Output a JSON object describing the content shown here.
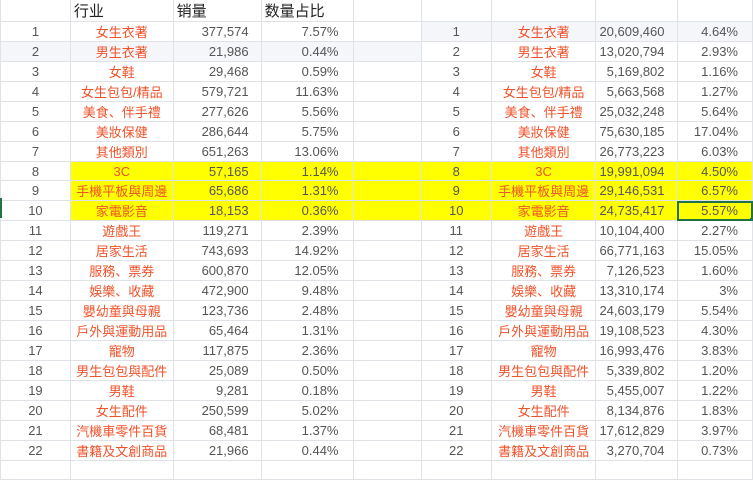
{
  "headers": {
    "category": "行业",
    "sales": "销量",
    "share": "数量占比"
  },
  "left": [
    {
      "n": "1",
      "cat": "女生衣著",
      "sales": "377,574",
      "pct": "7.57%"
    },
    {
      "n": "2",
      "cat": "男生衣著",
      "sales": "21,986",
      "pct": "0.44%"
    },
    {
      "n": "3",
      "cat": "女鞋",
      "sales": "29,468",
      "pct": "0.59%"
    },
    {
      "n": "4",
      "cat": "女生包包/精品",
      "sales": "579,721",
      "pct": "11.63%"
    },
    {
      "n": "5",
      "cat": "美食、伴手禮",
      "sales": "277,626",
      "pct": "5.56%"
    },
    {
      "n": "6",
      "cat": "美妝保健",
      "sales": "286,644",
      "pct": "5.75%"
    },
    {
      "n": "7",
      "cat": "其他類別",
      "sales": "651,263",
      "pct": "13.06%"
    },
    {
      "n": "8",
      "cat": "3C",
      "sales": "57,165",
      "pct": "1.14%"
    },
    {
      "n": "9",
      "cat": "手機平板與周邊",
      "sales": "65,686",
      "pct": "1.31%"
    },
    {
      "n": "10",
      "cat": "家電影音",
      "sales": "18,153",
      "pct": "0.36%"
    },
    {
      "n": "11",
      "cat": "遊戲王",
      "sales": "119,271",
      "pct": "2.39%"
    },
    {
      "n": "12",
      "cat": "居家生活",
      "sales": "743,693",
      "pct": "14.92%"
    },
    {
      "n": "13",
      "cat": "服務、票券",
      "sales": "600,870",
      "pct": "12.05%"
    },
    {
      "n": "14",
      "cat": "娛樂、收藏",
      "sales": "472,900",
      "pct": "9.48%"
    },
    {
      "n": "15",
      "cat": "嬰幼童與母親",
      "sales": "123,736",
      "pct": "2.48%"
    },
    {
      "n": "16",
      "cat": "戶外與運動用品",
      "sales": "65,464",
      "pct": "1.31%"
    },
    {
      "n": "17",
      "cat": "寵物",
      "sales": "117,875",
      "pct": "2.36%"
    },
    {
      "n": "18",
      "cat": "男生包包與配件",
      "sales": "25,089",
      "pct": "0.50%"
    },
    {
      "n": "19",
      "cat": "男鞋",
      "sales": "9,281",
      "pct": "0.18%"
    },
    {
      "n": "20",
      "cat": "女生配件",
      "sales": "250,599",
      "pct": "5.02%"
    },
    {
      "n": "21",
      "cat": "汽機車零件百貨",
      "sales": "68,481",
      "pct": "1.37%"
    },
    {
      "n": "22",
      "cat": "書籍及文創商品",
      "sales": "21,966",
      "pct": "0.44%"
    }
  ],
  "right": [
    {
      "n": "1",
      "cat": "女生衣著",
      "sales": "20,609,460",
      "pct": "4.64%"
    },
    {
      "n": "2",
      "cat": "男生衣著",
      "sales": "13,020,794",
      "pct": "2.93%"
    },
    {
      "n": "3",
      "cat": "女鞋",
      "sales": "5,169,802",
      "pct": "1.16%"
    },
    {
      "n": "4",
      "cat": "女生包包/精品",
      "sales": "5,663,568",
      "pct": "1.27%"
    },
    {
      "n": "5",
      "cat": "美食、伴手禮",
      "sales": "25,032,248",
      "pct": "5.64%"
    },
    {
      "n": "6",
      "cat": "美妝保健",
      "sales": "75,630,185",
      "pct": "17.04%"
    },
    {
      "n": "7",
      "cat": "其他類別",
      "sales": "26,773,223",
      "pct": "6.03%"
    },
    {
      "n": "8",
      "cat": "3C",
      "sales": "19,991,094",
      "pct": "4.50%"
    },
    {
      "n": "9",
      "cat": "手機平板與周邊",
      "sales": "29,146,531",
      "pct": "6.57%"
    },
    {
      "n": "10",
      "cat": "家電影音",
      "sales": "24,735,417",
      "pct": "5.57%"
    },
    {
      "n": "11",
      "cat": "遊戲王",
      "sales": "10,104,400",
      "pct": "2.27%"
    },
    {
      "n": "12",
      "cat": "居家生活",
      "sales": "66,771,163",
      "pct": "15.05%"
    },
    {
      "n": "13",
      "cat": "服務、票券",
      "sales": "7,126,523",
      "pct": "1.60%"
    },
    {
      "n": "14",
      "cat": "娛樂、收藏",
      "sales": "13,310,174",
      "pct": "3%"
    },
    {
      "n": "15",
      "cat": "嬰幼童與母親",
      "sales": "24,603,179",
      "pct": "5.54%"
    },
    {
      "n": "16",
      "cat": "戶外與運動用品",
      "sales": "19,108,523",
      "pct": "4.30%"
    },
    {
      "n": "17",
      "cat": "寵物",
      "sales": "16,993,476",
      "pct": "3.83%"
    },
    {
      "n": "18",
      "cat": "男生包包與配件",
      "sales": "5,339,802",
      "pct": "1.20%"
    },
    {
      "n": "19",
      "cat": "男鞋",
      "sales": "5,455,007",
      "pct": "1.22%"
    },
    {
      "n": "20",
      "cat": "女生配件",
      "sales": "8,134,876",
      "pct": "1.83%"
    },
    {
      "n": "21",
      "cat": "汽機車零件百貨",
      "sales": "17,612,829",
      "pct": "3.97%"
    },
    {
      "n": "22",
      "cat": "書籍及文創商品",
      "sales": "3,270,704",
      "pct": "0.73%"
    }
  ]
}
